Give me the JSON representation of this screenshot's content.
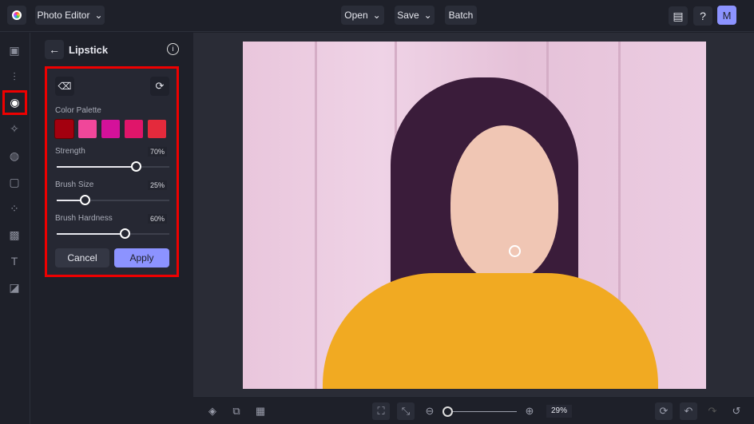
{
  "topbar": {
    "app_menu": "Photo Editor",
    "open": "Open",
    "save": "Save",
    "batch": "Batch",
    "avatar": "M"
  },
  "panel": {
    "title": "Lipstick",
    "color_palette_label": "Color Palette",
    "colors": [
      "#a3000f",
      "#f0479a",
      "#d4119a",
      "#e0156a",
      "#e42a3c"
    ],
    "sliders": [
      {
        "label": "Strength",
        "value": "70%",
        "fraction": 0.7
      },
      {
        "label": "Brush Size",
        "value": "25%",
        "fraction": 0.25
      },
      {
        "label": "Brush Hardness",
        "value": "60%",
        "fraction": 0.6
      }
    ],
    "cancel": "Cancel",
    "apply": "Apply"
  },
  "bottom": {
    "zoom": "29%",
    "zoom_fraction": 0.05
  }
}
